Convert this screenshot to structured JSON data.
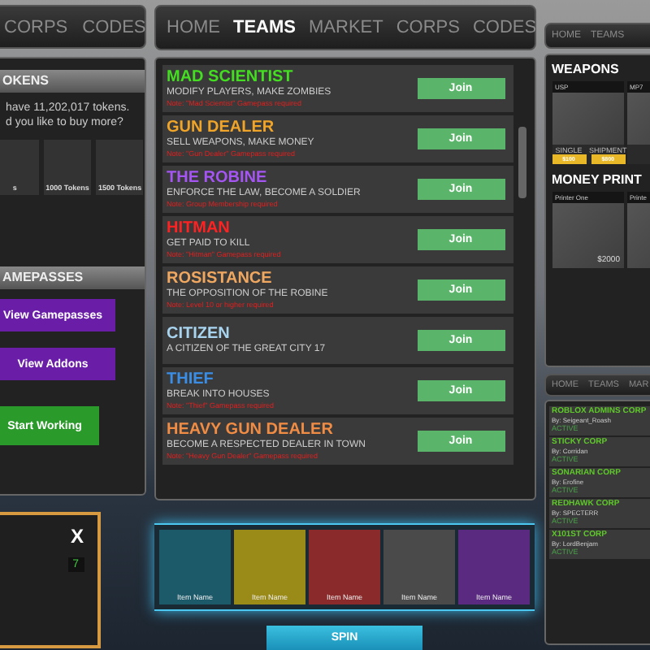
{
  "left": {
    "nav": [
      "CORPS",
      "CODES"
    ],
    "tokens": {
      "title": "OKENS",
      "lines": [
        "have 11,202,017 tokens.",
        "d you like to buy more?"
      ],
      "packs": [
        "s",
        "1000 Tokens",
        "1500 Tokens"
      ]
    },
    "gamepasses": {
      "title": "AMEPASSES",
      "buttons": [
        {
          "label": "View Gamepasses",
          "kind": "purple"
        },
        {
          "label": "View Addons",
          "kind": "purple"
        },
        {
          "label": "Start Working",
          "kind": "green"
        }
      ]
    },
    "crate": {
      "title": "X",
      "value": "7"
    }
  },
  "center": {
    "nav": [
      {
        "label": "HOME",
        "selected": false
      },
      {
        "label": "TEAMS",
        "selected": true
      },
      {
        "label": "MARKET",
        "selected": false
      },
      {
        "label": "CORPS",
        "selected": false
      },
      {
        "label": "CODES",
        "selected": false
      }
    ],
    "teams": [
      {
        "name": "MAD SCIENTIST",
        "color": "#44dd22",
        "description": "MODIFY PLAYERS, MAKE ZOMBIES",
        "note": "Note: \"Mad Scientist\" Gamepass required",
        "button": "Join"
      },
      {
        "name": "GUN DEALER",
        "color": "#f0a428",
        "description": "SELL WEAPONS, MAKE MONEY",
        "note": "Note: \"Gun Dealer\" Gamepass required",
        "button": "Join"
      },
      {
        "name": "THE ROBINE",
        "color": "#a455f2",
        "description": "ENFORCE THE LAW, BECOME A SOLDIER",
        "note": "Note: Group Membership required",
        "button": "Join"
      },
      {
        "name": "HITMAN",
        "color": "#ff2222",
        "description": "GET PAID TO KILL",
        "note": "Note: \"Hitman\" Gamepass required",
        "button": "Join"
      },
      {
        "name": "ROSISTANCE",
        "color": "#f0a860",
        "description": "THE OPPOSITION OF THE ROBINE",
        "note": "Note: Level 10 or higher required",
        "button": "Join"
      },
      {
        "name": "CITIZEN",
        "color": "#a8d4f0",
        "description": "A CITIZEN OF THE GREAT CITY 17",
        "button": "Join"
      },
      {
        "name": "THIEF",
        "color": "#3a8ee6",
        "description": "BREAK INTO HOUSES",
        "note": "Note: \"Thief\" Gamepass required",
        "button": "Join"
      },
      {
        "name": "HEAVY GUN DEALER",
        "color": "#f08c44",
        "description": "BECOME A RESPECTED DEALER IN TOWN",
        "note": "Note: \"Heavy Gun Dealer\" Gamepass required",
        "button": "Join"
      }
    ],
    "spinner": {
      "items": [
        {
          "label": "Item Name",
          "color": "#1c5a6a"
        },
        {
          "label": "Item Name",
          "color": "#9a8a18"
        },
        {
          "label": "Item Name",
          "color": "#8a2a2a"
        },
        {
          "label": "Item Name",
          "color": "#4a4a4a"
        },
        {
          "label": "Item Name",
          "color": "#5a2a80"
        }
      ],
      "button": "SPIN"
    }
  },
  "right": {
    "nav": [
      "HOME",
      "TEAMS"
    ],
    "weapons": {
      "title": "WEAPONS",
      "items": [
        {
          "name": "USP",
          "prices": [
            {
              "label": "SINGLE",
              "price": "$100"
            },
            {
              "label": "SHIPMENT",
              "price": "$800"
            }
          ]
        },
        {
          "name": "MP7"
        }
      ]
    },
    "printers": {
      "title": "MONEY PRINT",
      "items": [
        {
          "name": "Printer One",
          "price": "$2000"
        },
        {
          "name": "Printe"
        }
      ]
    },
    "nav2": [
      "HOME",
      "TEAMS",
      "MAR"
    ],
    "corps": [
      {
        "name": "ROBLOX ADMINS CORP",
        "owner": "By: Seigeant_Roash",
        "status": "ACTIVE"
      },
      {
        "name": "STICKY CORP",
        "owner": "By: Corridan",
        "status": "ACTIVE"
      },
      {
        "name": "SONARIAN CORP",
        "owner": "By: Erofine",
        "status": "ACTIVE"
      },
      {
        "name": "REDHAWK CORP",
        "owner": "By: SPECTERR",
        "status": "ACTIVE"
      },
      {
        "name": "X101ST CORP",
        "owner": "By: LordBenjam",
        "status": "ACTIVE"
      }
    ]
  }
}
